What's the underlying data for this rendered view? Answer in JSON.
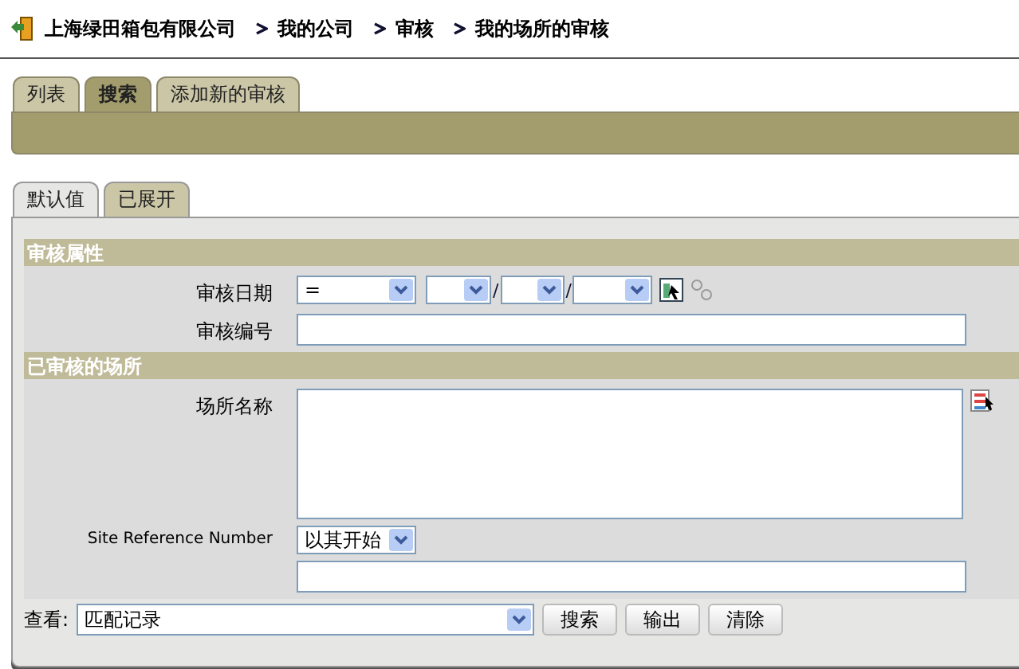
{
  "breadcrumb": [
    "上海绿田箱包有限公司",
    "我的公司",
    "审核",
    "我的场所的审核"
  ],
  "tabs": [
    {
      "label": "列表",
      "selected": false
    },
    {
      "label": "搜索",
      "selected": true
    },
    {
      "label": "添加新的审核",
      "selected": false
    }
  ],
  "subtabs": [
    {
      "label": "默认值",
      "selected": true
    },
    {
      "label": "已展开",
      "selected": false
    }
  ],
  "sections": [
    {
      "title": "审核属性",
      "fields": [
        {
          "kind": "date",
          "label": "审核日期",
          "operator": "=",
          "separators": [
            "/",
            "/"
          ]
        },
        {
          "kind": "text",
          "label": "审核编号"
        }
      ]
    },
    {
      "title": "已审核的场所",
      "fields": [
        {
          "kind": "textarea",
          "label": "场所名称"
        },
        {
          "kind": "match",
          "label": "Site Reference Number",
          "operator": "以其开始"
        }
      ]
    }
  ],
  "view": {
    "label": "查看:",
    "value": "匹配记录"
  },
  "buttons": [
    "搜索",
    "输出",
    "清除"
  ]
}
